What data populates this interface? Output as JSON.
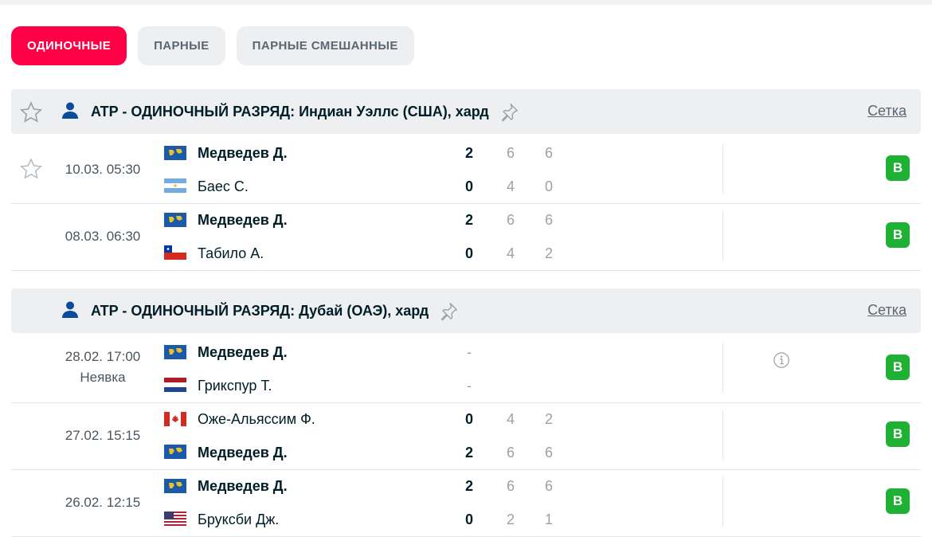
{
  "tabs": [
    {
      "label": "ОДИНОЧНЫЕ",
      "active": true
    },
    {
      "label": "ПАРНЫЕ",
      "active": false
    },
    {
      "label": "ПАРНЫЕ СМЕШАННЫЕ",
      "active": false
    }
  ],
  "leagues": [
    {
      "prefix": "ATP - ОДИНОЧНЫЙ РАЗРЯД:",
      "name": "Индиан Уэллс (США), хард",
      "link": "Сетка",
      "matches": [
        {
          "date": "10.03. 05:30",
          "status": "",
          "p1": "Медведев Д.",
          "p1_flag": "world",
          "p1_win": true,
          "p1_score": "2",
          "p1_sets": [
            "6",
            "6"
          ],
          "p2": "Баес С.",
          "p2_flag": "argentina",
          "p2_win": false,
          "p2_score": "0",
          "p2_sets": [
            "4",
            "0"
          ],
          "result": "В"
        },
        {
          "date": "08.03. 06:30",
          "status": "",
          "p1": "Медведев Д.",
          "p1_flag": "world",
          "p1_win": true,
          "p1_score": "2",
          "p1_sets": [
            "6",
            "6"
          ],
          "p2": "Табило А.",
          "p2_flag": "chile",
          "p2_win": false,
          "p2_score": "0",
          "p2_sets": [
            "4",
            "2"
          ],
          "result": "В"
        }
      ]
    },
    {
      "prefix": "ATP - ОДИНОЧНЫЙ РАЗРЯД:",
      "name": "Дубай (ОАЭ), хард",
      "link": "Сетка",
      "matches": [
        {
          "date": "28.02. 17:00",
          "status": "Неявка",
          "p1": "Медведев Д.",
          "p1_flag": "world",
          "p1_win": true,
          "p1_score": "-",
          "p1_sets": [],
          "p2": "Грикспур Т.",
          "p2_flag": "netherlands",
          "p2_win": false,
          "p2_score": "-",
          "p2_sets": [],
          "result": "В"
        },
        {
          "date": "27.02. 15:15",
          "status": "",
          "p1": "Оже-Альяссим Ф.",
          "p1_flag": "canada",
          "p1_win": false,
          "p1_score": "0",
          "p1_sets": [
            "4",
            "2"
          ],
          "p2": "Медведев Д.",
          "p2_flag": "world",
          "p2_win": true,
          "p2_score": "2",
          "p2_sets": [
            "6",
            "6"
          ],
          "result": "В"
        },
        {
          "date": "26.02. 12:15",
          "status": "",
          "p1": "Медведев Д.",
          "p1_flag": "world",
          "p1_win": true,
          "p1_score": "2",
          "p1_sets": [
            "6",
            "6"
          ],
          "p2": "Бруксби Дж.",
          "p2_flag": "usa",
          "p2_win": false,
          "p2_score": "0",
          "p2_sets": [
            "2",
            "1"
          ],
          "result": "В"
        }
      ]
    }
  ],
  "icons": {
    "favorite": "star-outline-icon",
    "player": "person-icon",
    "pin": "pin-icon",
    "info": "info-icon"
  },
  "colors": {
    "accent": "#ff0046",
    "win_badge": "#1fb134",
    "header_bg": "#eeeff1"
  }
}
